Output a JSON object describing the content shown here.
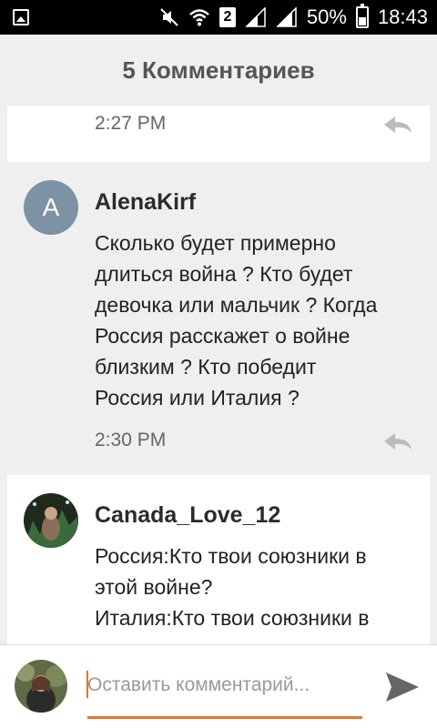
{
  "status_bar": {
    "sim": "2",
    "battery": "50%",
    "battery_level": 0.5,
    "time": "18:43",
    "icons": [
      "photo-icon",
      "mute-icon",
      "wifi-icon",
      "sim-badge",
      "signal-icon",
      "signal-icon",
      "battery-icon"
    ]
  },
  "header": {
    "title": "5 Комментариев"
  },
  "comments": [
    {
      "time": "2:27 PM"
    },
    {
      "author": "AlenaKirf",
      "avatar_letter": "A",
      "lines": [
        "Сколько будет примерно",
        "длиться война ? Кто будет",
        "девочка или мальчик ? Когда",
        "Россия расскажет о войне",
        "близким ? Кто победит",
        "Россия или Италия ?"
      ],
      "time": "2:30 PM"
    },
    {
      "author": "Canada_Love_12",
      "lines": [
        "Россия:Кто твои союзники в",
        "этой войне?",
        "Италия:Кто твои союзники в"
      ]
    }
  ],
  "composer": {
    "placeholder": "Оставить комментарий..."
  },
  "colors": {
    "accent": "#e8742a",
    "avatar_bg": "#7d92a4",
    "background": "#efefef"
  }
}
